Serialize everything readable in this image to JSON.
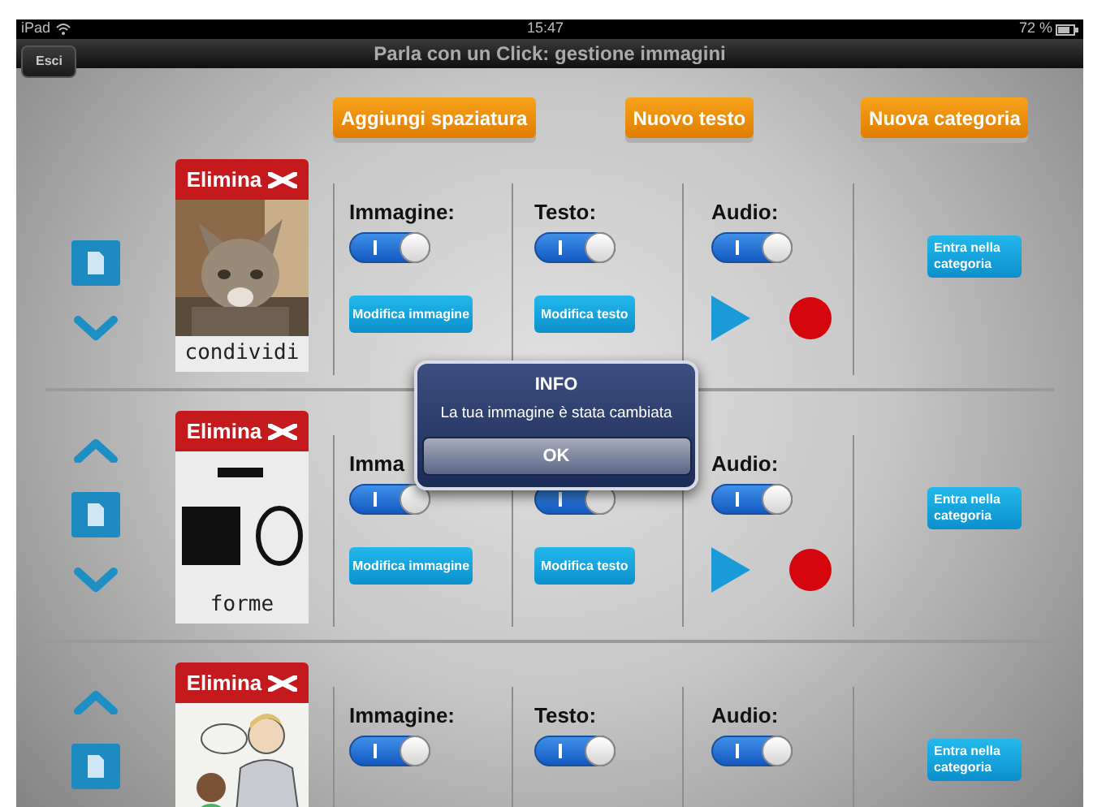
{
  "status_bar": {
    "device": "iPad",
    "time": "15:47",
    "battery": "72 %"
  },
  "nav_bar": {
    "back_button": "Esci",
    "title": "Parla con un Click: gestione immagini"
  },
  "toolbar": [
    "Aggiungi spaziatura",
    "Nuovo testo",
    "Nuova categoria"
  ],
  "rows": [
    {
      "move_up": false,
      "move_down": true,
      "delete_button": "Elimina",
      "label": "condividi",
      "switches": [
        {
          "label": "Immagine:",
          "on": true
        },
        {
          "label": "Testo:",
          "on": true
        },
        {
          "label": "Audio:",
          "on": true
        }
      ],
      "image_button": "Modifica immagine",
      "text_button": "Modifica testo",
      "audio_controls": true,
      "category_button": "Entra nella categoria"
    },
    {
      "move_up": true,
      "move_down": true,
      "delete_button": "Elimina",
      "kind": "shapes",
      "label": "forme",
      "switches": [
        {
          "label": "Imma",
          "on": true
        },
        {
          "on": true
        },
        {
          "label": "Audio:",
          "on": true
        }
      ],
      "image_button": "Modifica immagine",
      "text_button": "Modifica testo",
      "audio_controls": true,
      "category_button": "Entra nella categoria"
    },
    {
      "move_up": true,
      "move_down": false,
      "delete_button": "Elimina",
      "kind": "illustration",
      "switches": [
        {
          "label": "Immagine:",
          "on": true
        },
        {
          "label": "Testo:",
          "on": true
        },
        {
          "label": "Audio:",
          "on": true
        }
      ],
      "audio_controls": false,
      "category_button": "Entra nella categoria"
    }
  ],
  "alert": {
    "title": "INFO",
    "message": "La tua immagine è stata cambiata",
    "button": "OK"
  }
}
